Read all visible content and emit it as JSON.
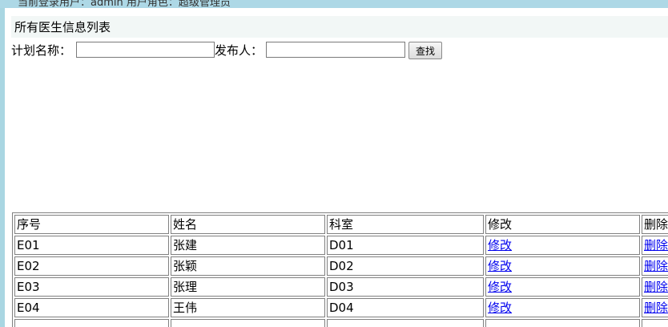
{
  "top_bar": {
    "text": "当前登录用户：admin 用户角色：超级管理员"
  },
  "page": {
    "title": "所有医生信息列表"
  },
  "search": {
    "plan_name_label": "计划名称：",
    "plan_name_value": "",
    "publisher_label": "发布人：",
    "publisher_value": "",
    "button_label": "查找"
  },
  "table": {
    "headers": [
      "序号",
      "姓名",
      "科室",
      "修改",
      "删除"
    ],
    "rows": [
      {
        "id": "E01",
        "name": "张建",
        "dept": "D01",
        "edit": "修改",
        "delete": "删除"
      },
      {
        "id": "E02",
        "name": "张颖",
        "dept": "D02",
        "edit": "修改",
        "delete": "删除"
      },
      {
        "id": "E03",
        "name": "张理",
        "dept": "D03",
        "edit": "修改",
        "delete": "删除"
      },
      {
        "id": "E04",
        "name": "王伟",
        "dept": "D04",
        "edit": "修改",
        "delete": "删除"
      },
      {
        "id": "",
        "name": "",
        "dept": "",
        "edit": "",
        "delete": ""
      }
    ]
  }
}
